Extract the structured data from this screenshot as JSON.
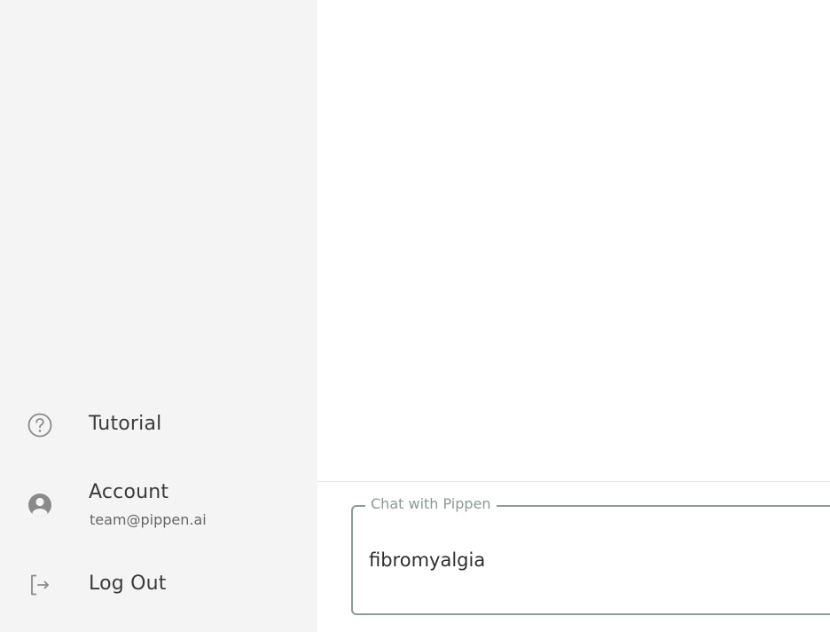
{
  "sidebar": {
    "items": [
      {
        "label": "Tutorial",
        "icon": "help-circle-icon"
      },
      {
        "label": "Account",
        "sublabel": "team@pippen.ai",
        "icon": "account-circle-icon"
      },
      {
        "label": "Log Out",
        "icon": "logout-icon"
      }
    ]
  },
  "chat": {
    "legend": "Chat with Pippen",
    "value": "fibromyalgia"
  },
  "colors": {
    "sidebar_bg": "#f4f4f4",
    "field_border": "#8e9a96",
    "icon": "#8a8a8a"
  }
}
